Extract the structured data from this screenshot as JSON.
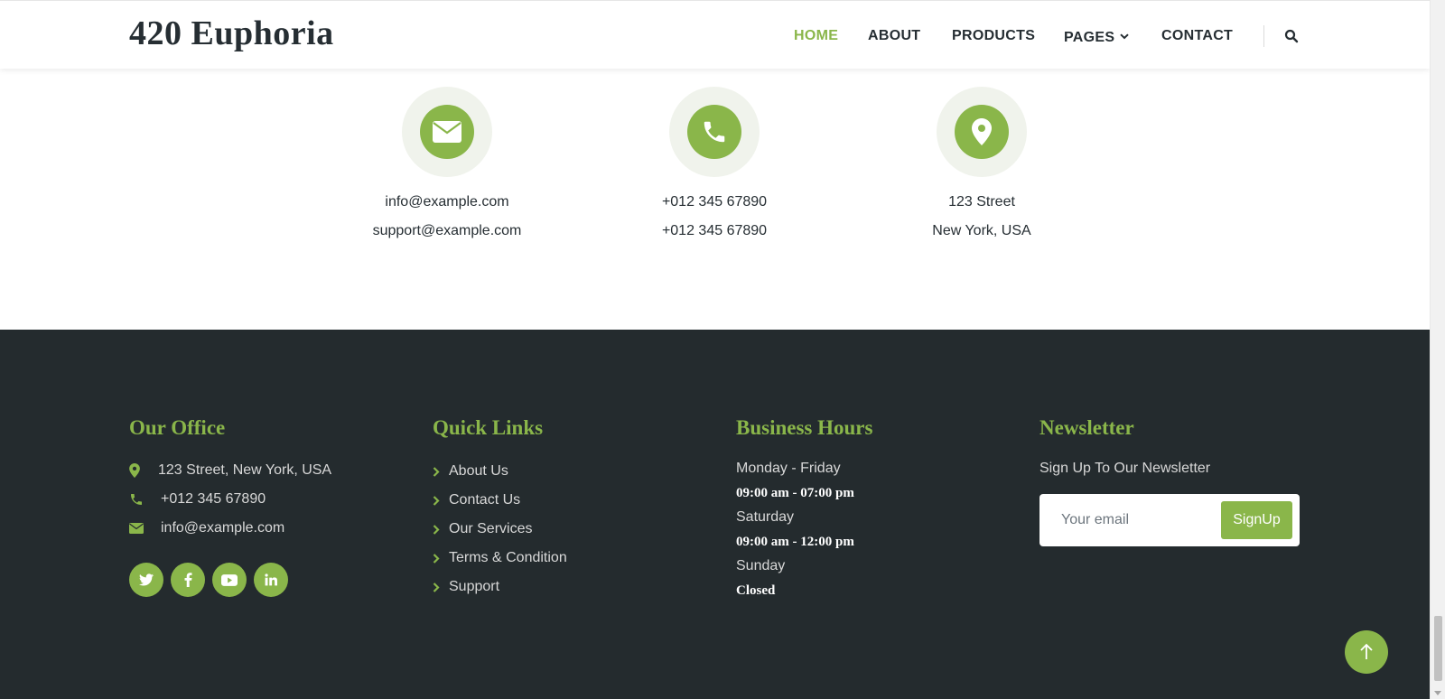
{
  "brand": {
    "name": "420 Euphoria"
  },
  "nav": {
    "items": [
      {
        "label": "HOME"
      },
      {
        "label": "ABOUT"
      },
      {
        "label": "PRODUCTS"
      },
      {
        "label": "PAGES"
      },
      {
        "label": "CONTACT"
      }
    ]
  },
  "contact": {
    "email": {
      "line1": "info@example.com",
      "line2": "support@example.com"
    },
    "phone": {
      "line1": "+012 345 67890",
      "line2": "+012 345 67890"
    },
    "address": {
      "line1": "123 Street",
      "line2": "New York, USA"
    }
  },
  "footer": {
    "office": {
      "title": "Our Office",
      "address": "123 Street, New York, USA",
      "phone": "+012 345 67890",
      "email": "info@example.com"
    },
    "quick_links": {
      "title": "Quick Links",
      "links": [
        "About Us",
        "Contact Us",
        "Our Services",
        "Terms & Condition",
        "Support"
      ]
    },
    "hours": {
      "title": "Business Hours",
      "weekday_label": "Monday - Friday",
      "weekday_time": "09:00 am - 07:00 pm",
      "saturday_label": "Saturday",
      "saturday_time": "09:00 am - 12:00 pm",
      "sunday_label": "Sunday",
      "sunday_time": "Closed"
    },
    "newsletter": {
      "title": "Newsletter",
      "text": "Sign Up To Our Newsletter",
      "placeholder": "Your email",
      "button": "SignUp"
    }
  },
  "colors": {
    "accent": "#8ab64a",
    "dark": "#242b2e",
    "text": "#262e33"
  }
}
